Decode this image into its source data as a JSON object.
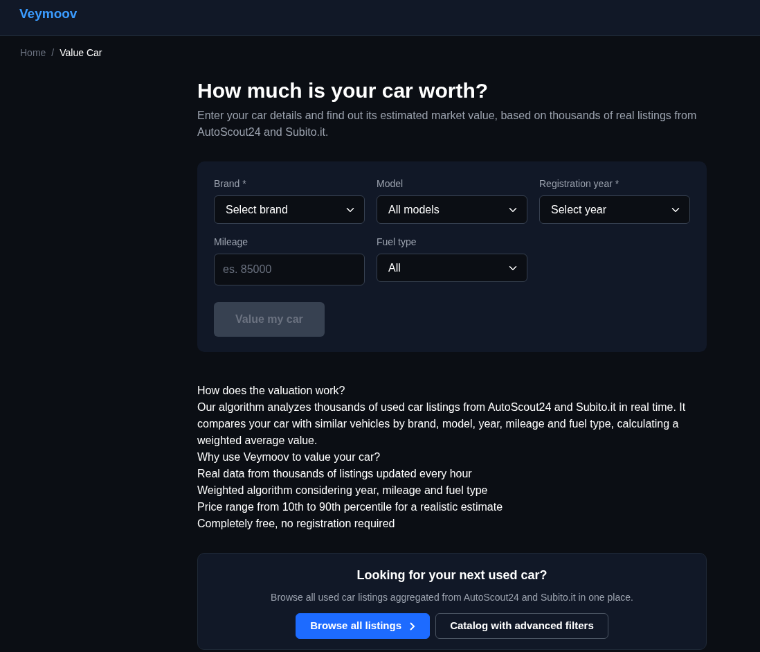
{
  "navbar": {
    "brand": "Veymoov"
  },
  "breadcrumb": [
    {
      "label": "Home",
      "active": false
    },
    {
      "label": "Value Car",
      "active": true
    }
  ],
  "breadcrumb_separator": "/",
  "title": "How much is your car worth?",
  "subtitle": "Enter your car details and find out its estimated market value, based on thousands of real listings from AutoScout24 and Subito.it.",
  "form": {
    "fields": [
      {
        "label": "Brand *",
        "kind": "select",
        "value": "Select brand"
      },
      {
        "label": "Model",
        "kind": "select",
        "value": "All models"
      },
      {
        "label": "Registration year *",
        "kind": "select",
        "value": "Select year"
      },
      {
        "label": "Mileage",
        "kind": "input",
        "placeholder": "es. 85000"
      },
      {
        "label": "Fuel type",
        "kind": "select",
        "value": "All"
      }
    ],
    "submit": {
      "label": "Value my car",
      "disabled": true
    }
  },
  "info_lines": [
    "How does the valuation work?",
    "Our algorithm analyzes thousands of used car listings from AutoScout24 and Subito.it in real time. It compares your car with similar vehicles by brand, model, year, mileage and fuel type, calculating a weighted average value.",
    "Why use Veymoov to value your car?",
    "Real data from thousands of listings updated every hour",
    "Weighted algorithm considering year, mileage and fuel type",
    "Price range from 10th to 90th percentile for a realistic estimate",
    "Completely free, no registration required"
  ],
  "promo": {
    "title": "Looking for your next used car?",
    "text": "Browse all used car listings aggregated from AutoScout24 and Subito.it in one place.",
    "buttons": [
      {
        "label": "Browse all listings",
        "kind": "primary"
      },
      {
        "label": "Catalog with advanced filters",
        "kind": "outline"
      }
    ]
  }
}
